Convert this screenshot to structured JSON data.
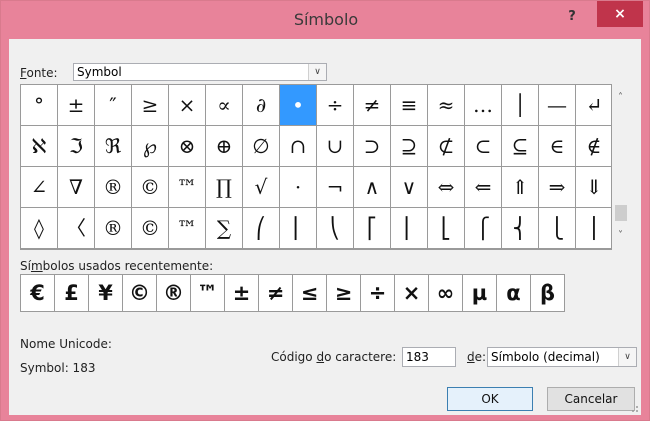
{
  "window": {
    "title": "Símbolo",
    "help": "?",
    "close": "×"
  },
  "font": {
    "label": "Fonte:",
    "value": "Symbol",
    "dropdown": "∨"
  },
  "symbol_grid": {
    "rows": [
      [
        "°",
        "±",
        "″",
        "≥",
        "×",
        "∝",
        "∂",
        "•",
        "÷",
        "≠",
        "≡",
        "≈",
        "…",
        "│",
        "—",
        "↵"
      ],
      [
        "ℵ",
        "ℑ",
        "ℜ",
        "℘",
        "⊗",
        "⊕",
        "∅",
        "∩",
        "∪",
        "⊃",
        "⊇",
        "⊄",
        "⊂",
        "⊆",
        "∈",
        "∉"
      ],
      [
        "∠",
        "∇",
        "®",
        "©",
        "™",
        "∏",
        "√",
        "·",
        "¬",
        "∧",
        "∨",
        "⇔",
        "⇐",
        "⇑",
        "⇒",
        "⇓"
      ],
      [
        "◊",
        "〈",
        "®",
        "©",
        "™",
        "∑",
        "⎛",
        "⎜",
        "⎝",
        "⎡",
        "⎢",
        "⎣",
        "⎧",
        "⎨",
        "⎩",
        "⎪"
      ]
    ],
    "selected": [
      0,
      7
    ]
  },
  "scrollbar": {
    "up": "˄",
    "down": "˅"
  },
  "recent": {
    "label": "Símbolos usados recentemente:",
    "symbols": [
      "€",
      "£",
      "¥",
      "©",
      "®",
      "™",
      "±",
      "≠",
      "≤",
      "≥",
      "÷",
      "×",
      "∞",
      "µ",
      "α",
      "β"
    ]
  },
  "unicode": {
    "label": "Nome Unicode:",
    "value": "Symbol: 183"
  },
  "char_code": {
    "label": "Código do caractere:",
    "value": "183"
  },
  "from": {
    "label": "de:",
    "value": "Símbolo (decimal)",
    "dropdown": "∨"
  },
  "buttons": {
    "ok": "OK",
    "cancel": "Cancelar"
  }
}
